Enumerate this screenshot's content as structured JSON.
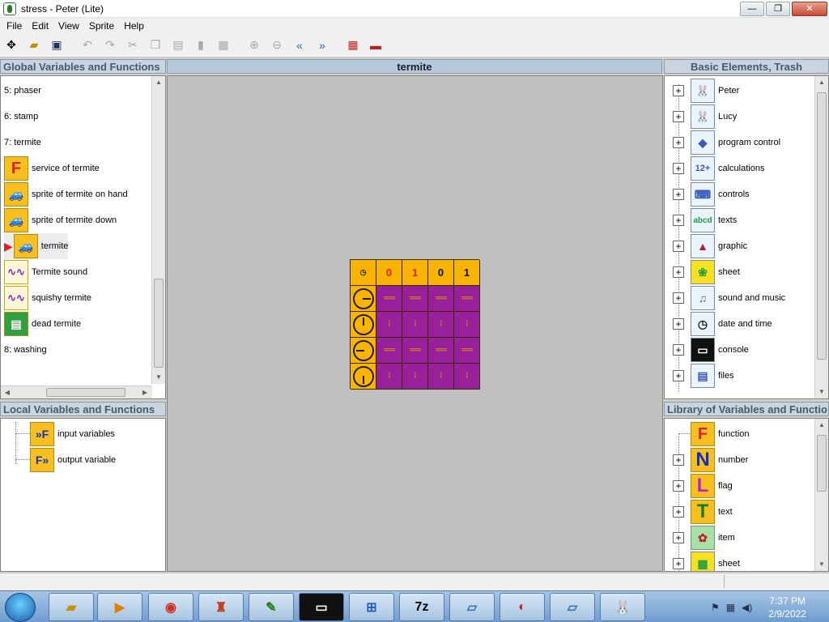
{
  "window": {
    "title": "stress - Peter (Lite)",
    "min": "—",
    "max": "❐",
    "close": "✕"
  },
  "menu": [
    "File",
    "Edit",
    "View",
    "Sprite",
    "Help"
  ],
  "panels": {
    "global": {
      "title": "Global Variables and Functions",
      "items": [
        {
          "label": "5: phaser",
          "icon": ""
        },
        {
          "label": "6: stamp",
          "icon": ""
        },
        {
          "label": "7: termite",
          "icon": ""
        },
        {
          "label": "service of termite",
          "icon": "F"
        },
        {
          "label": "sprite of termite on hand",
          "icon": "car"
        },
        {
          "label": "sprite of termite down",
          "icon": "car"
        },
        {
          "label": "termite",
          "icon": "car"
        },
        {
          "label": "Termite sound",
          "icon": "wave"
        },
        {
          "label": "squishy termite",
          "icon": "wave"
        },
        {
          "label": "dead termite",
          "icon": "house"
        },
        {
          "label": "8: washing",
          "icon": ""
        }
      ]
    },
    "local": {
      "title": "Local Variables and Functions",
      "items": [
        {
          "label": "input variables"
        },
        {
          "label": "output variable"
        }
      ]
    },
    "center": {
      "title": "termite"
    },
    "basic": {
      "title": "Basic Elements, Trash",
      "items": [
        "Peter",
        "Lucy",
        "program control",
        "calculations",
        "controls",
        "texts",
        "graphic",
        "sheet",
        "sound and music",
        "date and time",
        "console",
        "files"
      ]
    },
    "library": {
      "title": "Library of Variables and Functio",
      "items": [
        {
          "label": "function",
          "glyph": "F"
        },
        {
          "label": "number",
          "glyph": "N"
        },
        {
          "label": "flag",
          "glyph": "L"
        },
        {
          "label": "text",
          "glyph": "T"
        },
        {
          "label": "item",
          "glyph": "✿"
        },
        {
          "label": "sheet",
          "glyph": "▦"
        }
      ]
    }
  },
  "grid": {
    "header": [
      "0",
      "1",
      "0",
      "1"
    ],
    "rows": 4
  },
  "taskbar": {
    "time": "7:37 PM",
    "date": "2/9/2022",
    "apps": [
      "folder",
      "media",
      "chrome",
      "game",
      "editor",
      "console",
      "network",
      "7z",
      "notepad",
      "peter",
      "writer",
      "bunny"
    ]
  }
}
